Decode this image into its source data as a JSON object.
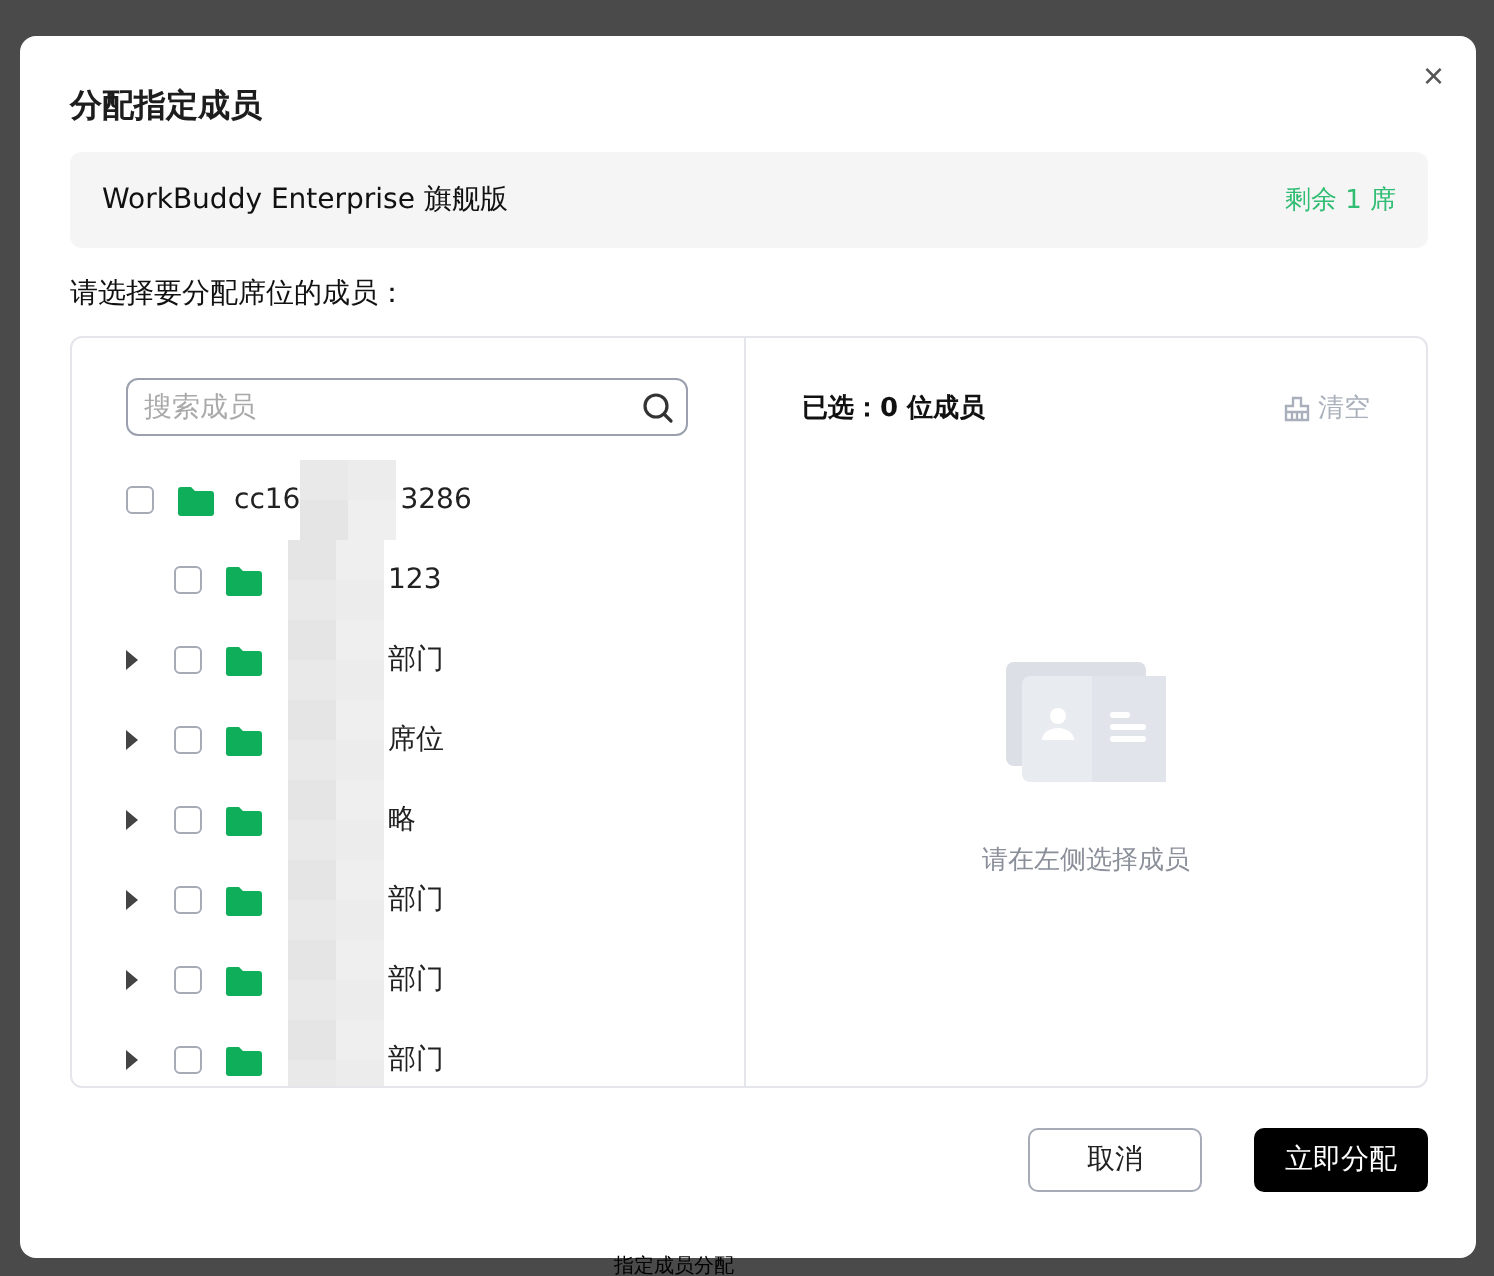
{
  "backdrop": {
    "text": "指定成员分配"
  },
  "dialog": {
    "title": "分配指定成员",
    "close": "×",
    "plan": {
      "name": "WorkBuddy Enterprise 旗舰版",
      "remaining": "剩余 1 席"
    },
    "prompt": "请选择要分配席位的成员：",
    "search": {
      "placeholder": "搜索成员"
    },
    "tree": [
      {
        "label_start": "cc16",
        "label_end": "3286",
        "checked": false,
        "expandable": false,
        "children": [
          {
            "label_end": "123",
            "checked": false,
            "expandable": false
          },
          {
            "label_end": "部门",
            "checked": false,
            "expandable": true
          },
          {
            "label_end": "席位",
            "checked": false,
            "expandable": true
          },
          {
            "label_end": "略",
            "checked": false,
            "expandable": true
          },
          {
            "label_end": "部门",
            "checked": false,
            "expandable": true
          },
          {
            "label_end": "部门",
            "checked": false,
            "expandable": true
          },
          {
            "label_end": "部门",
            "checked": false,
            "expandable": true
          }
        ]
      }
    ],
    "selected_summary": "已选：0 位成员",
    "clear": "清空",
    "empty_hint": "请在左侧选择成员",
    "buttons": [
      {
        "label": "取消",
        "kind": "secondary"
      },
      {
        "label": "立即分配",
        "kind": "primary"
      }
    ]
  }
}
